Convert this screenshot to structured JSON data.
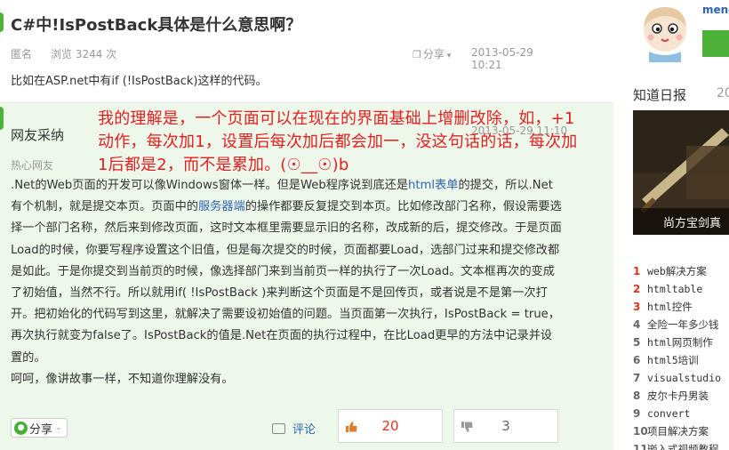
{
  "question": {
    "title": "C#中!IsPostBack具体是什么意思啊？",
    "author": "匿名",
    "views": "浏览 3244 次",
    "share_label": "分享",
    "time": "2013-05-29 10:21",
    "body": "比如在ASP.net中有if (!IsPostBack)这样的代码。"
  },
  "answer": {
    "author": "网友采纳",
    "level": "热心网友",
    "time": "2013-05-29 11:10",
    "overlay_note": "我的理解是，一个页面可以在现在的界面基础上增删改除，如，+1动作，每次加1，设置后每次加后都会加一，没这句话的话，每次加1后都是2，而不是累加。(☉__☉)b",
    "body": {
      "p1_a": ".Net的Web页面的开发可以像Windows窗体一样。但是Web程序说到底还是",
      "p1_link": "html表单",
      "p1_b": "的提交，所以.Net有个机制，就是提交本页。页面中的",
      "p1_link2": "服务器端",
      "p1_c": "的操作都要反复提交到本页。比如修改部门名称，假设需要选择一个部门名称，然后来到修改页面，这时文本框里需要显示旧的名称，改成新的后，提交修改。于是页面Load的时候，你要写程序设置这个旧值，但是每次提交的时候，页面都要Load，选部门过来和提交修改都是如此。于是你提交到当前页的时候，像选择部门来到当前页一样的执行了一次Load。文本框再次的变成了初始值，当然不行。所以就用if( !IsPostBack )来判断这个页面是不是回传页，或者说是不是第一次打开。把初始化的代码写到这里，就解决了需要设初始值的问题。当页面第一次执行，IsPostBack = true，再次执行就变为false了。IsPostBack的值是.Net在页面的执行过程中，在比Load更早的方法中记录并设置的。",
      "p2": "呵呵，像讲故事一样，不知道你理解没有。"
    },
    "share_label": "分享",
    "comment_label": "评论",
    "upvotes": "20",
    "downvotes": "3"
  },
  "sidebar": {
    "user": "meng",
    "news_title": "知道日报",
    "news_date": "20",
    "news_caption": "尚方宝剑真",
    "related": [
      {
        "num": "1",
        "text": "web解决方案"
      },
      {
        "num": "2",
        "text": "htmltable"
      },
      {
        "num": "3",
        "text": "html控件"
      },
      {
        "num": "4",
        "text": "全险一年多少钱"
      },
      {
        "num": "5",
        "text": "html网页制作"
      },
      {
        "num": "6",
        "text": "html5培训"
      },
      {
        "num": "7",
        "text": "visualstudio"
      },
      {
        "num": "8",
        "text": "皮尔卡丹男装"
      },
      {
        "num": "9",
        "text": "convert"
      },
      {
        "num": "10",
        "text": "项目解决方案"
      },
      {
        "num": "11",
        "text": "嵌入式视频教程"
      }
    ]
  },
  "colors": {
    "accent_green": "#4cb23a",
    "answer_bg": "#eef8ea",
    "link_blue": "#2d64b3",
    "note_red": "#e02020",
    "hot_rank_red": "#e0331e"
  }
}
